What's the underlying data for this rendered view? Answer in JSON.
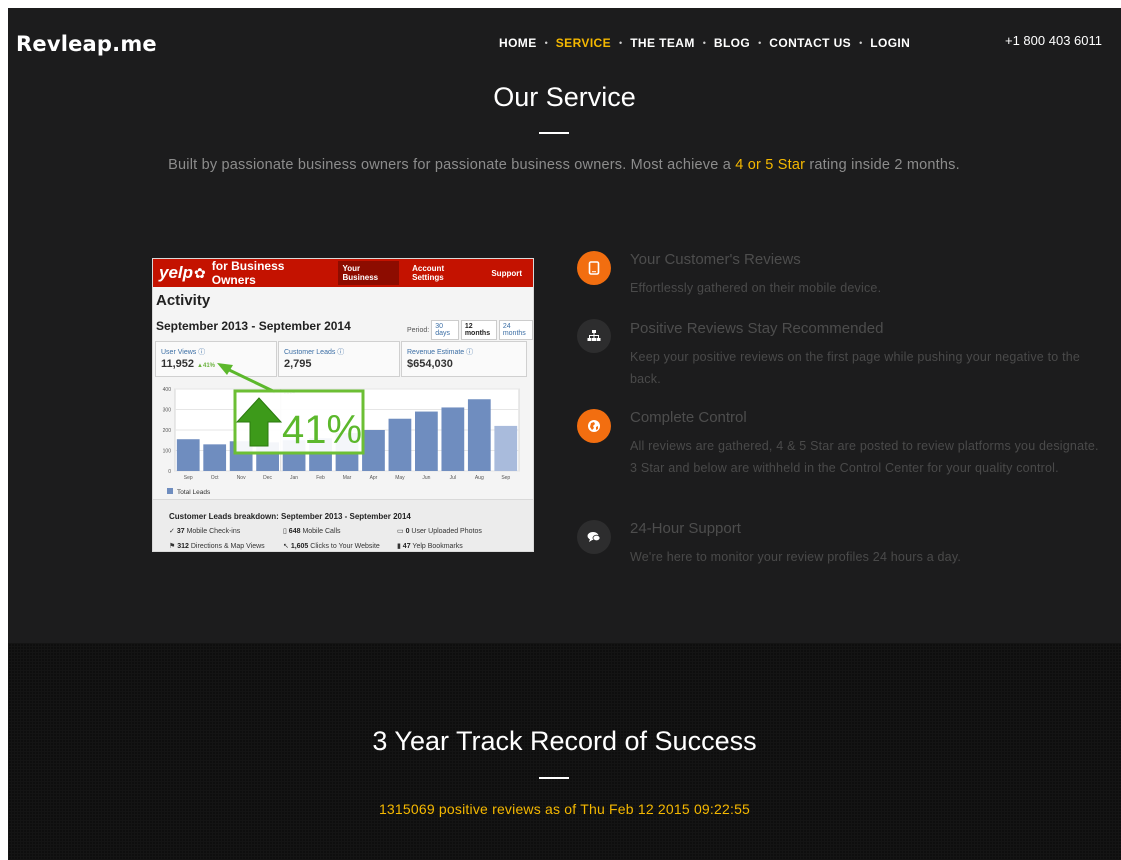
{
  "brand": "Revleap.me",
  "nav": [
    "HOME",
    "SERVICE",
    "THE TEAM",
    "BLOG",
    "CONTACT US",
    "LOGIN"
  ],
  "nav_active": "SERVICE",
  "phone": "+1 800 403 6011",
  "service": {
    "title": "Our Service",
    "intro_before": "Built by passionate business owners for passionate business owners. Most achieve a ",
    "intro_highlight": "4 or 5 Star",
    "intro_after": " rating inside 2 months."
  },
  "yelp": {
    "logo": "yelp",
    "subtitle": "for Business Owners",
    "tabs": [
      "Your Business",
      "Account Settings",
      "Support"
    ],
    "heading": "Activity",
    "period_title": "September 2013 - September 2014",
    "period_label": "Period:",
    "period_options": [
      "30 days",
      "12 months",
      "24 months"
    ],
    "stats": [
      {
        "label": "User Views",
        "value": "11,952",
        "delta": "41%"
      },
      {
        "label": "Customer Leads",
        "value": "2,795"
      },
      {
        "label": "Revenue Estimate",
        "value": "$654,030"
      }
    ],
    "overlay": "41%",
    "breakdown_title": "Customer Leads breakdown: September 2013 - September 2014",
    "breakdown": [
      {
        "n": "37",
        "t": "Mobile Check-ins"
      },
      {
        "n": "648",
        "t": "Mobile Calls"
      },
      {
        "n": "0",
        "t": "User Uploaded Photos"
      },
      {
        "n": "312",
        "t": "Directions & Map Views"
      },
      {
        "n": "1,605",
        "t": "Clicks to Your Website"
      },
      {
        "n": "47",
        "t": "Yelp Bookmarks"
      }
    ]
  },
  "chart_data": {
    "type": "bar",
    "categories": [
      "Sep",
      "Oct",
      "Nov",
      "Dec",
      "Jan",
      "Feb",
      "Mar",
      "Apr",
      "May",
      "Jun",
      "Jul",
      "Aug",
      "Sep"
    ],
    "values": [
      155,
      130,
      145,
      140,
      150,
      160,
      185,
      200,
      255,
      290,
      310,
      350,
      220
    ],
    "ylim": [
      0,
      400
    ],
    "yticks": [
      "400",
      "300",
      "200",
      "100",
      "0"
    ],
    "year_marker": "2014",
    "legend": "Total Leads"
  },
  "features": [
    {
      "icon": "mobile-icon",
      "title": "Your Customer's Reviews",
      "text": "Effortlessly gathered on their mobile device."
    },
    {
      "icon": "sitemap-icon",
      "title": "Positive Reviews Stay Recommended",
      "text": "Keep your positive reviews on the first page while pushing your negative to the back."
    },
    {
      "icon": "globe-icon",
      "title": "Complete Control",
      "text": "All reviews are gathered, 4 & 5 Star are posted to review platforms you designate. 3 Star and below are withheld in the Control Center for your quality control."
    },
    {
      "icon": "chat-icon",
      "title": "24-Hour Support",
      "text": "We're here to monitor your review profiles 24 hours a day."
    }
  ],
  "track": {
    "title": "3 Year Track Record of Success",
    "counter": "1315069 positive reviews as of  Thu Feb 12 2015 09:22:55"
  },
  "colors": {
    "accent": "#f5b800",
    "orange": "#f26e10",
    "yelp_red": "#c41200",
    "bar": "#6f8dbf"
  }
}
